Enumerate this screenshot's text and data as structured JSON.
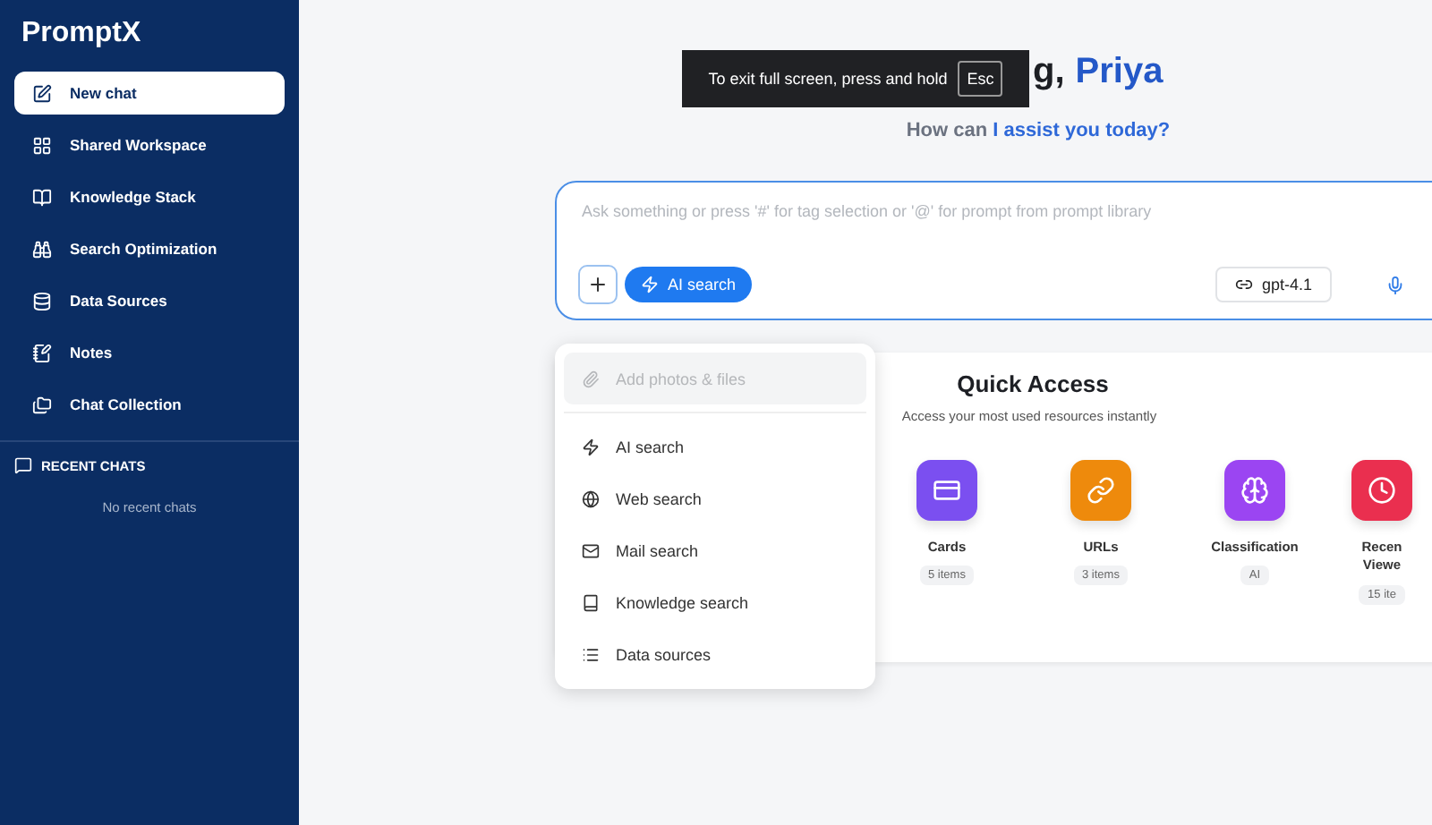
{
  "sidebar": {
    "brand": "PromptX",
    "items": [
      {
        "label": "New chat",
        "selected": true
      },
      {
        "label": "Shared Workspace",
        "selected": false
      },
      {
        "label": "Knowledge Stack",
        "selected": false
      },
      {
        "label": "Search Optimization",
        "selected": false
      },
      {
        "label": "Data Sources",
        "selected": false
      },
      {
        "label": "Notes",
        "selected": false
      },
      {
        "label": "Chat Collection",
        "selected": false
      }
    ],
    "recent": {
      "title": "RECENT CHATS",
      "empty": "No recent chats"
    }
  },
  "fullscreen_notice": {
    "text": "To exit full screen, press and hold",
    "key": "Esc"
  },
  "greeting": {
    "visible_part": "g,",
    "name": "Priya"
  },
  "subtitle": {
    "lead": "How can",
    "highlight": "I assist you today?"
  },
  "prompt": {
    "placeholder": "Ask something or press '#' for tag selection or '@' for prompt from prompt library",
    "mode": "AI search",
    "model": "gpt-4.1"
  },
  "menu": {
    "items": [
      {
        "label": "Add photos & files",
        "disabled": true
      },
      {
        "label": "AI search",
        "disabled": false
      },
      {
        "label": "Web search",
        "disabled": false
      },
      {
        "label": "Mail search",
        "disabled": false
      },
      {
        "label": "Knowledge search",
        "disabled": false
      },
      {
        "label": "Data sources",
        "disabled": false
      }
    ]
  },
  "quick_access": {
    "title": "Quick Access",
    "subtitle": "Access your most used resources instantly",
    "items": [
      {
        "title": "Cards",
        "badge": "5 items",
        "color": "#7b4ff0"
      },
      {
        "title": "URLs",
        "badge": "3 items",
        "color": "#ee8a0c"
      },
      {
        "title": "Classification",
        "badge": "AI",
        "color": "#9b45f2"
      },
      {
        "title": "Recen Viewe",
        "badge": "15 ite",
        "color": "#ea2f4f"
      }
    ]
  }
}
